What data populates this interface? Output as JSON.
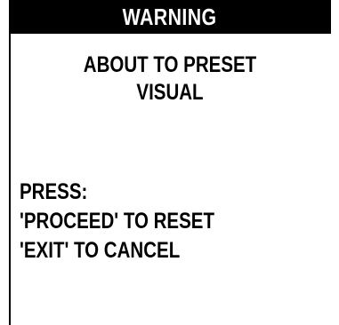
{
  "dialog": {
    "title": "WARNING",
    "message": [
      "ABOUT TO PRESET",
      "VISUAL"
    ],
    "instructions": [
      "PRESS:",
      "'PROCEED' TO RESET",
      "'EXIT' TO CANCEL"
    ]
  },
  "colors": {
    "title_bar_background": "#000000",
    "title_text": "#ffffff",
    "body_text": "#000000",
    "background": "#ffffff"
  }
}
